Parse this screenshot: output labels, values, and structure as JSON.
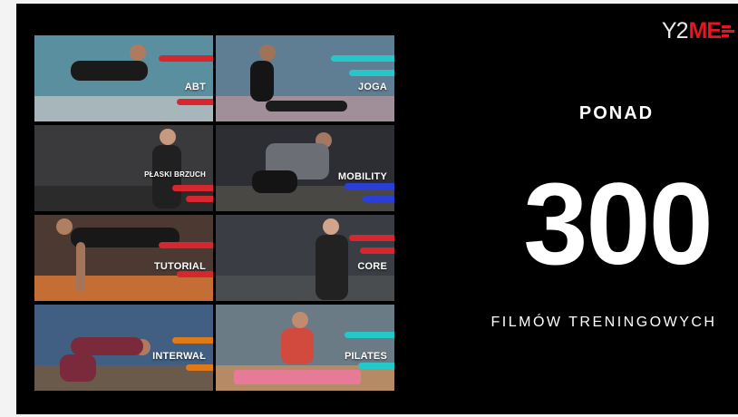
{
  "logo": {
    "text_y2": "Y2",
    "text_me": "ME"
  },
  "tiles": [
    {
      "label": "ABT",
      "bg": "#5a8fa0",
      "floor": "#a7b6bb",
      "accent": "#d8262e"
    },
    {
      "label": "JOGA",
      "bg": "#5f7e93",
      "floor": "#a08e98",
      "accent": "#25c7c9"
    },
    {
      "label": "PŁASKI BRZUCH",
      "bg": "#3a3a3c",
      "floor": "#2c2b2b",
      "accent": "#d8262e"
    },
    {
      "label": "MOBILITY",
      "bg": "#2c2e33",
      "floor": "#4a4845",
      "accent": "#2a3fd6"
    },
    {
      "label": "TUTORIAL",
      "bg": "#4c3a32",
      "floor": "#c46d34",
      "accent": "#d8262e"
    },
    {
      "label": "CORE",
      "bg": "#3a3e44",
      "floor": "#4a4d50",
      "accent": "#d8262e"
    },
    {
      "label": "INTERWAŁ",
      "bg": "#415f82",
      "floor": "#6a5a4c",
      "accent": "#e07a18"
    },
    {
      "label": "PILATES",
      "bg": "#6b7b86",
      "floor": "#b48b65",
      "accent": "#25c7c9"
    }
  ],
  "headline": {
    "ponad": "PONAD",
    "number": "300",
    "subtitle": "FILMÓW TRENINGOWYCH"
  }
}
